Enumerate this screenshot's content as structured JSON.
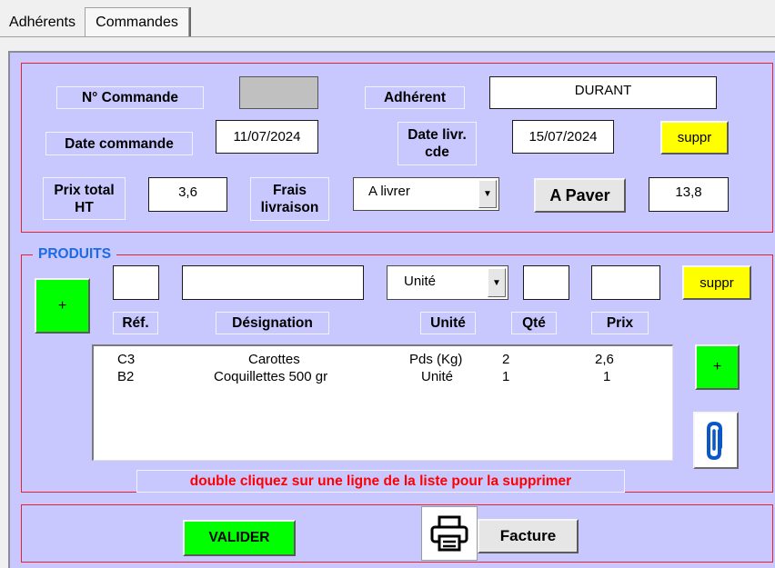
{
  "tabs": [
    {
      "label": "Adhérents",
      "active": false
    },
    {
      "label": "Commandes",
      "active": true
    }
  ],
  "commande": {
    "num_commande_label": "N° Commande",
    "num_commande_value": "",
    "adherent_label": "Adhérent",
    "adherent_value": "DURANT",
    "date_commande_label": "Date commande",
    "date_commande_value": "11/07/2024",
    "date_livr_label_line1": "Date livr.",
    "date_livr_label_line2": "cde",
    "date_livr_value": "15/07/2024",
    "suppr_label": "suppr",
    "prix_total_label_line1": "Prix total",
    "prix_total_label_line2": "HT",
    "prix_total_value": "3,6",
    "frais_label_line1": "Frais",
    "frais_label_line2": "livraison",
    "frais_value": "A livrer",
    "a_payer_label": "A Paver",
    "a_payer_value": "13,8"
  },
  "produits": {
    "title": "PRODUITS",
    "add_label": "+",
    "inputs": {
      "ref": "",
      "designation": "",
      "unite": "Unité",
      "qte": "",
      "prix": ""
    },
    "suppr_label": "suppr",
    "headers": {
      "ref": "Réf.",
      "designation": "Désignation",
      "unite": "Unité",
      "qte": "Qté",
      "prix": "Prix"
    },
    "rows": [
      {
        "ref": "C3",
        "designation": "Carottes",
        "unite": "Pds (Kg)",
        "qte": "2",
        "prix": "2,6"
      },
      {
        "ref": "B2",
        "designation": "Coquillettes 500 gr",
        "unite": "Unité",
        "qte": "1",
        "prix": "1"
      }
    ],
    "list_add_label": "+",
    "hint": "double cliquez sur une ligne de la liste pour la supprimer"
  },
  "footer": {
    "valider_label": "VALIDER",
    "facture_label": "Facture"
  },
  "colors": {
    "panel": "#c8c8ff",
    "frame": "#e8212e",
    "accent_green": "#00ff00",
    "accent_yellow": "#ffff00",
    "produits_title": "#1c6ae6",
    "hint": "#ff0000"
  },
  "icons": [
    "printer-icon",
    "paperclip-icon",
    "dropdown-arrow-icon"
  ]
}
